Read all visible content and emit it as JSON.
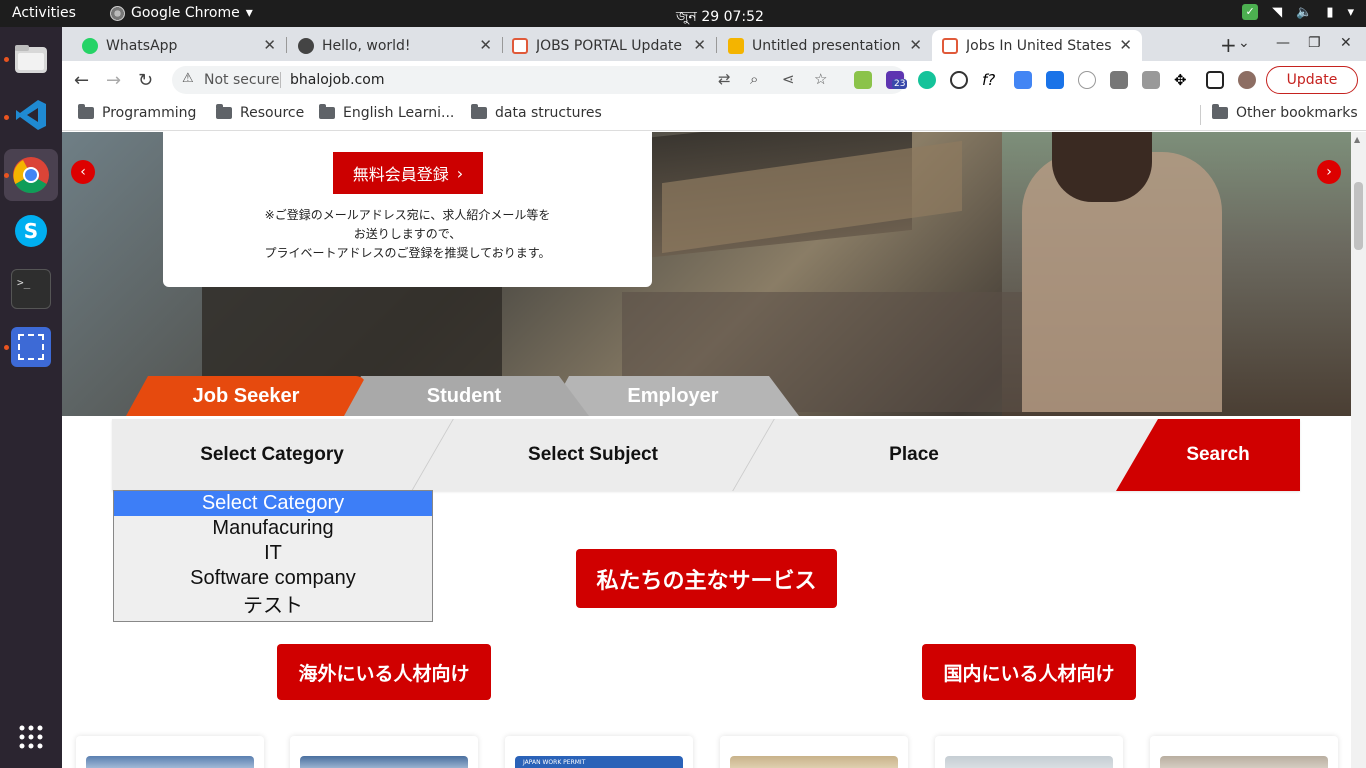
{
  "system": {
    "activities": "Activities",
    "app_name": "Google Chrome",
    "clock": "জুন 29  07:52"
  },
  "browser": {
    "tabs": [
      {
        "title": "WhatsApp",
        "favicon_color": "#25d366"
      },
      {
        "title": "Hello, world!",
        "favicon_color": "#444444"
      },
      {
        "title": "JOBS PORTAL Update",
        "favicon_color": "#e05a3a"
      },
      {
        "title": "Untitled presentation",
        "favicon_color": "#f4b400"
      },
      {
        "title": "Jobs In United States",
        "favicon_color": "#e05a3a"
      }
    ],
    "new_tab": "+",
    "not_secure": "Not secure",
    "url": "bhalojob.com",
    "update_label": "Update",
    "extension_badge": "23",
    "bookmarks": [
      "Programming",
      "Resource",
      "English Learni...",
      "data structures"
    ],
    "other_bookmarks": "Other bookmarks"
  },
  "page": {
    "register_button": "無料会員登録",
    "register_note_line1": "※ご登録のメールアドレス宛に、求人紹介メール等を",
    "register_note_line2": "お送りしますので、",
    "register_note_line3": "プライベートアドレスのご登録を推奨しております。",
    "mode_tabs": [
      "Job Seeker",
      "Student",
      "Employer"
    ],
    "search": {
      "category": "Select Category",
      "subject": "Select Subject",
      "place": "Place",
      "button": "Search"
    },
    "category_options": [
      "Select Category",
      "Manufacuring",
      "IT",
      "Software company",
      "テスト"
    ],
    "services_heading": "私たちの主なサービス",
    "overseas_button": "海外にいる人材向け",
    "domestic_button": "国内にいる人材向け",
    "card_banner_text": "JAPAN WORK PERMIT"
  },
  "colors": {
    "accent_red": "#d00000",
    "job_seeker_tab": "#e64a0e",
    "inactive_tab": "#9e9e9e",
    "selected_option": "#3d7ef7"
  }
}
